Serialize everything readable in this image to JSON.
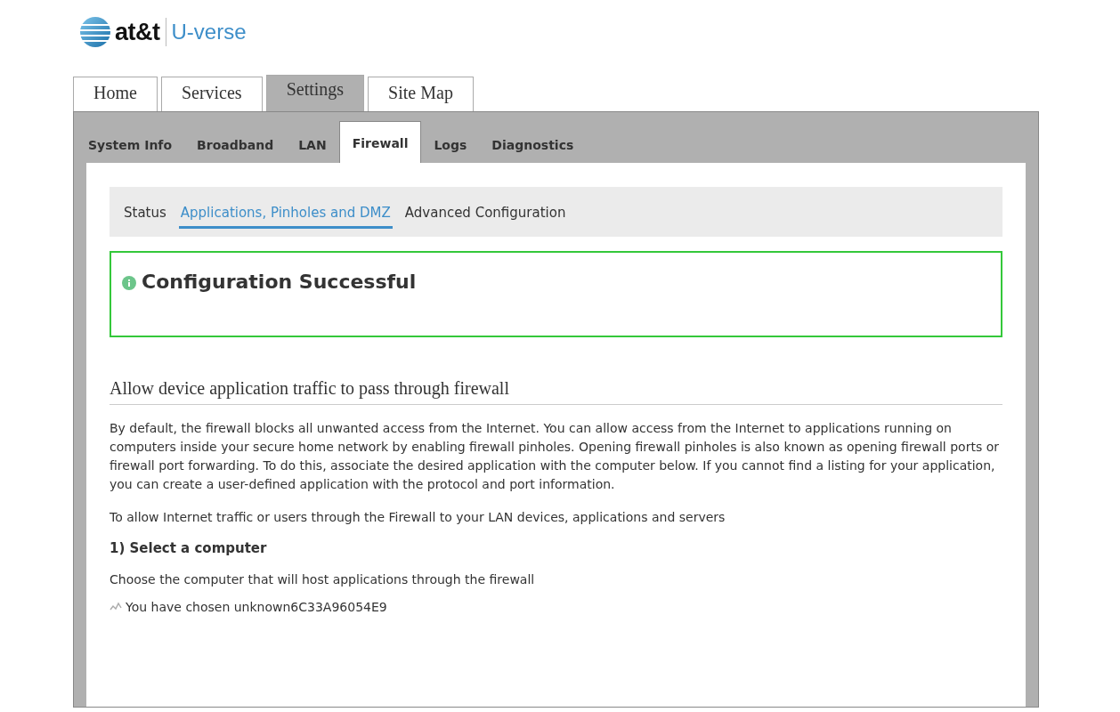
{
  "logo": {
    "brand": "at&t",
    "product": "U-verse"
  },
  "main_tabs": [
    {
      "label": "Home",
      "selected": false
    },
    {
      "label": "Services",
      "selected": false
    },
    {
      "label": "Settings",
      "selected": true
    },
    {
      "label": "Site Map",
      "selected": false
    }
  ],
  "sub_tabs": [
    {
      "label": "System Info",
      "selected": false
    },
    {
      "label": "Broadband",
      "selected": false
    },
    {
      "label": "LAN",
      "selected": false
    },
    {
      "label": "Firewall",
      "selected": true
    },
    {
      "label": "Logs",
      "selected": false
    },
    {
      "label": "Diagnostics",
      "selected": false
    }
  ],
  "section_nav": [
    {
      "label": "Status",
      "selected": false
    },
    {
      "label": "Applications, Pinholes and DMZ",
      "selected": true
    },
    {
      "label": "Advanced Configuration",
      "selected": false
    }
  ],
  "alert": {
    "message": "Configuration Successful"
  },
  "heading": "Allow device application traffic to pass through firewall",
  "intro": "By default, the firewall blocks all unwanted access from the Internet. You can allow access from the Internet to applications running on computers inside your secure home network by enabling firewall pinholes. Opening firewall pinholes is also known as opening firewall ports or firewall port forwarding. To do this, associate the desired application with the computer below. If you cannot find a listing for your application, you can create a user-defined application with the protocol and port information.",
  "note": "To allow Internet traffic or users through the Firewall to your LAN devices, applications and servers",
  "step": {
    "title": "1) Select a computer",
    "hint": "Choose the computer that will host applications through the firewall",
    "chosen": "You have chosen unknown6C33A96054E9"
  }
}
